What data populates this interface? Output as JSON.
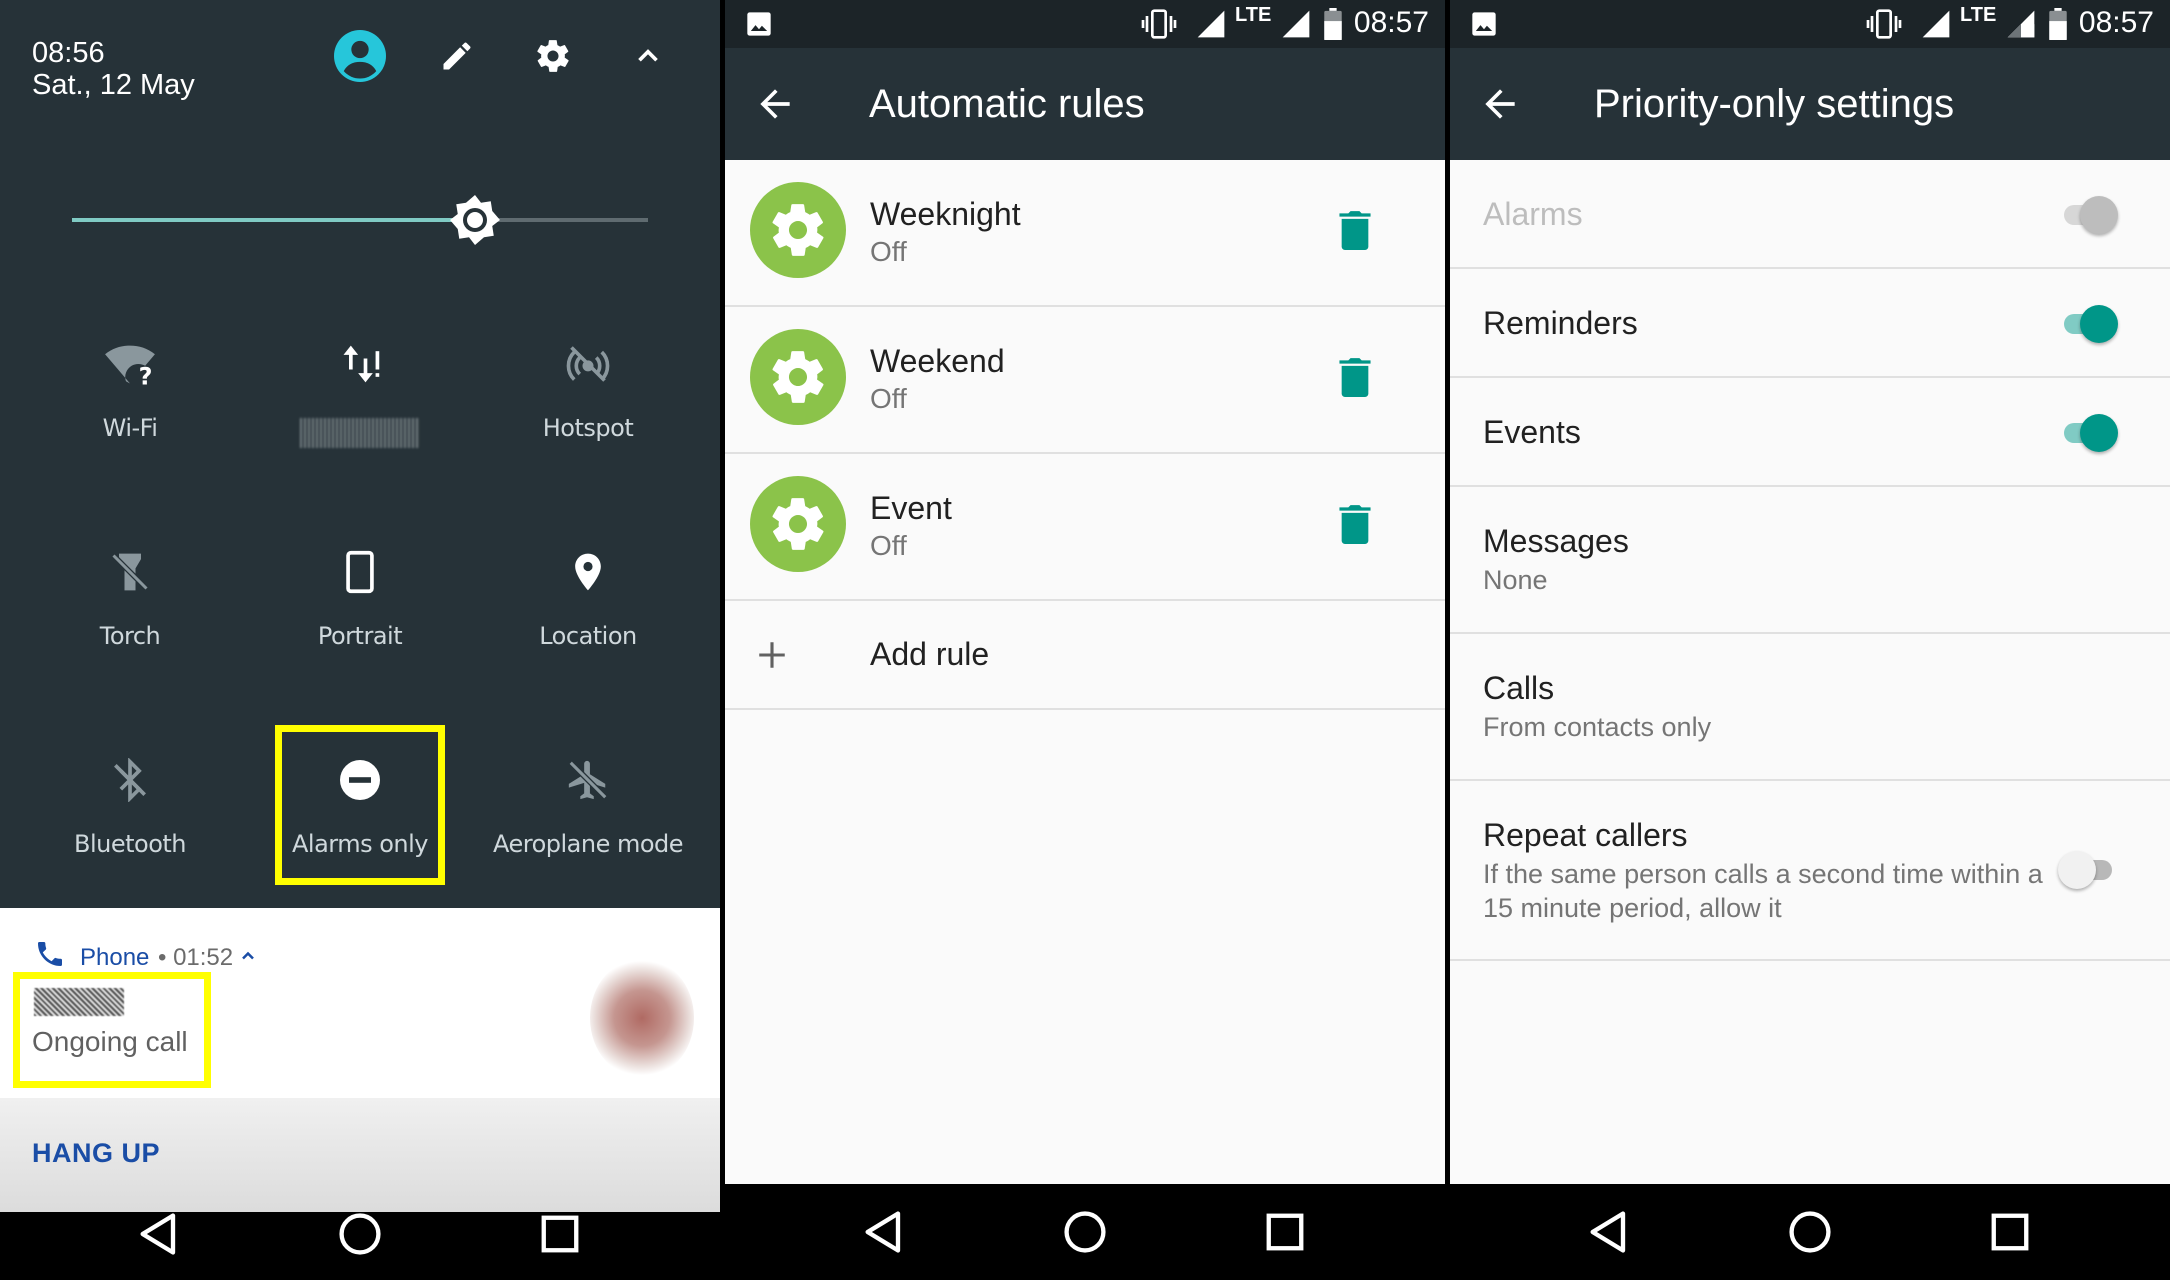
{
  "panel_quick_settings": {
    "time": "08:56",
    "date": "Sat., 12 May",
    "top_icons": [
      "account-icon",
      "edit-icon",
      "settings-icon",
      "collapse-icon"
    ],
    "brightness_level": 0.7,
    "tiles": [
      {
        "label": "Wi-Fi",
        "icon": "wifi-unknown-icon"
      },
      {
        "label": "",
        "icon": "mobile-data-icon"
      },
      {
        "label": "Hotspot",
        "icon": "hotspot-off-icon"
      },
      {
        "label": "Torch",
        "icon": "torch-off-icon"
      },
      {
        "label": "Portrait",
        "icon": "portrait-icon"
      },
      {
        "label": "Location",
        "icon": "location-icon"
      },
      {
        "label": "Bluetooth",
        "icon": "bluetooth-off-icon"
      },
      {
        "label": "Alarms only",
        "icon": "do-not-disturb-icon"
      },
      {
        "label": "Aeroplane mode",
        "icon": "airplane-off-icon"
      }
    ],
    "notification": {
      "app": "Phone",
      "elapsed": "• 01:52",
      "text": "Ongoing call",
      "action": "HANG UP"
    },
    "highlight_color": "#ffff00"
  },
  "panel_automatic_rules": {
    "status_time": "08:57",
    "status_lte": "LTE",
    "title": "Automatic rules",
    "rules": [
      {
        "name": "Weeknight",
        "state": "Off"
      },
      {
        "name": "Weekend",
        "state": "Off"
      },
      {
        "name": "Event",
        "state": "Off"
      }
    ],
    "add_rule_label": "Add rule",
    "accent_color": "#009688"
  },
  "panel_priority_settings": {
    "status_time": "08:57",
    "status_lte": "LTE",
    "title": "Priority-only settings",
    "prefs": [
      {
        "title": "Alarms",
        "subtitle": "",
        "toggle": "on-disabled"
      },
      {
        "title": "Reminders",
        "subtitle": "",
        "toggle": "on"
      },
      {
        "title": "Events",
        "subtitle": "",
        "toggle": "on"
      },
      {
        "title": "Messages",
        "subtitle": "None",
        "toggle": "none"
      },
      {
        "title": "Calls",
        "subtitle": "From contacts only",
        "toggle": "none"
      },
      {
        "title": "Repeat callers",
        "subtitle": "If the same person calls a second time within a 15 minute period, allow it",
        "toggle": "off"
      }
    ]
  }
}
